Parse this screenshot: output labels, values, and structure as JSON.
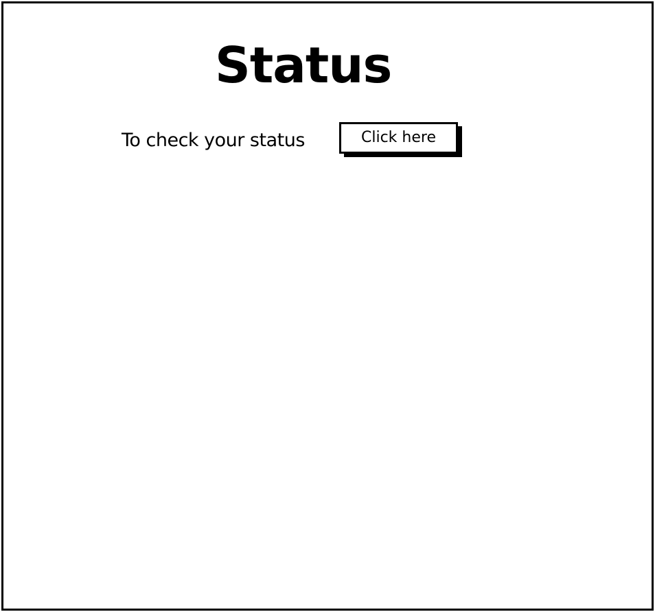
{
  "page": {
    "title": "Status",
    "prompt": "To check your status",
    "button_label": "Click here"
  }
}
